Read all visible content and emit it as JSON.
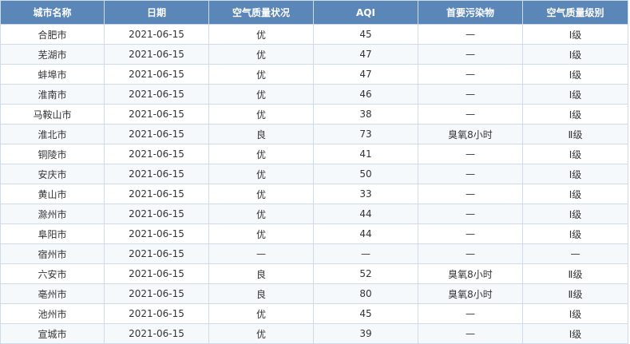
{
  "table": {
    "headers": [
      "城市名称",
      "日期",
      "空气质量状况",
      "AQI",
      "首要污染物",
      "空气质量级别"
    ],
    "rows": [
      [
        "合肥市",
        "2021-06-15",
        "优",
        "45",
        "—",
        "Ⅰ级"
      ],
      [
        "芜湖市",
        "2021-06-15",
        "优",
        "47",
        "—",
        "Ⅰ级"
      ],
      [
        "蚌埠市",
        "2021-06-15",
        "优",
        "47",
        "—",
        "Ⅰ级"
      ],
      [
        "淮南市",
        "2021-06-15",
        "优",
        "46",
        "—",
        "Ⅰ级"
      ],
      [
        "马鞍山市",
        "2021-06-15",
        "优",
        "38",
        "—",
        "Ⅰ级"
      ],
      [
        "淮北市",
        "2021-06-15",
        "良",
        "73",
        "臭氧8小时",
        "Ⅱ级"
      ],
      [
        "铜陵市",
        "2021-06-15",
        "优",
        "41",
        "—",
        "Ⅰ级"
      ],
      [
        "安庆市",
        "2021-06-15",
        "优",
        "50",
        "—",
        "Ⅰ级"
      ],
      [
        "黄山市",
        "2021-06-15",
        "优",
        "33",
        "—",
        "Ⅰ级"
      ],
      [
        "滁州市",
        "2021-06-15",
        "优",
        "44",
        "—",
        "Ⅰ级"
      ],
      [
        "阜阳市",
        "2021-06-15",
        "优",
        "44",
        "—",
        "Ⅰ级"
      ],
      [
        "宿州市",
        "2021-06-15",
        "—",
        "—",
        "—",
        "—"
      ],
      [
        "六安市",
        "2021-06-15",
        "良",
        "52",
        "臭氧8小时",
        "Ⅱ级"
      ],
      [
        "亳州市",
        "2021-06-15",
        "良",
        "80",
        "臭氧8小时",
        "Ⅱ级"
      ],
      [
        "池州市",
        "2021-06-15",
        "优",
        "45",
        "—",
        "Ⅰ级"
      ],
      [
        "宣城市",
        "2021-06-15",
        "优",
        "39",
        "—",
        "Ⅰ级"
      ]
    ]
  },
  "colors": {
    "header_bg": "#5b87b8",
    "header_text": "#ffffff",
    "border": "#cfdbe8",
    "cell_text": "#333333"
  }
}
